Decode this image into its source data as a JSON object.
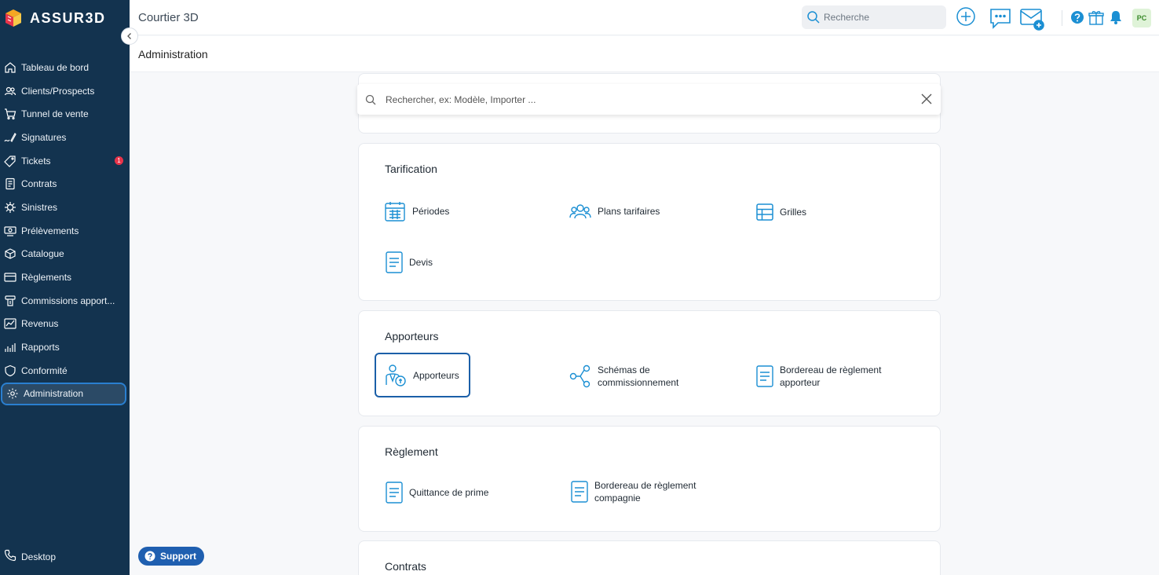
{
  "brand": {
    "name": "ASSUR3D"
  },
  "header": {
    "app_title": "Courtier 3D",
    "search_placeholder": "Recherche",
    "avatar_initials": "PC"
  },
  "page": {
    "title": "Administration"
  },
  "sidebar": {
    "items": [
      {
        "label": "Tableau de bord",
        "icon": "home-icon"
      },
      {
        "label": "Clients/Prospects",
        "icon": "users-icon"
      },
      {
        "label": "Tunnel de vente",
        "icon": "cart-icon"
      },
      {
        "label": "Signatures",
        "icon": "signature-icon"
      },
      {
        "label": "Tickets",
        "icon": "ticket-icon",
        "badge": "1"
      },
      {
        "label": "Contrats",
        "icon": "contract-icon"
      },
      {
        "label": "Sinistres",
        "icon": "virus-icon"
      },
      {
        "label": "Prélèvements",
        "icon": "money-icon"
      },
      {
        "label": "Catalogue",
        "icon": "box-icon"
      },
      {
        "label": "Règlements",
        "icon": "card-icon"
      },
      {
        "label": "Commissions apport...",
        "icon": "commission-icon"
      },
      {
        "label": "Revenus",
        "icon": "revenue-icon"
      },
      {
        "label": "Rapports",
        "icon": "report-icon"
      },
      {
        "label": "Conformité",
        "icon": "shield-icon"
      },
      {
        "label": "Administration",
        "icon": "gear-icon",
        "active": true
      }
    ],
    "footer": {
      "label": "Desktop",
      "icon": "phone-icon"
    }
  },
  "search_panel": {
    "placeholder": "Rechercher, ex: Modèle, Importer ..."
  },
  "sections": {
    "tarification": {
      "title": "Tarification",
      "items": [
        "Périodes",
        "Plans tarifaires",
        "Grilles",
        "Devis"
      ]
    },
    "apporteurs": {
      "title": "Apporteurs",
      "items": [
        "Apporteurs",
        "Schémas de",
        "commissionnement",
        "Bordereau de règlement",
        "apporteur"
      ]
    },
    "reglement": {
      "title": "Règlement",
      "items": [
        "Quittance de prime",
        "Bordereau de règlement",
        "compagnie"
      ]
    },
    "contrats": {
      "title": "Contrats"
    }
  },
  "support": {
    "label": "Support"
  },
  "colors": {
    "sidebar": "#13334f",
    "accent": "#1b8fd3",
    "active_border": "#2a7fd0",
    "badge": "#e8344a"
  }
}
